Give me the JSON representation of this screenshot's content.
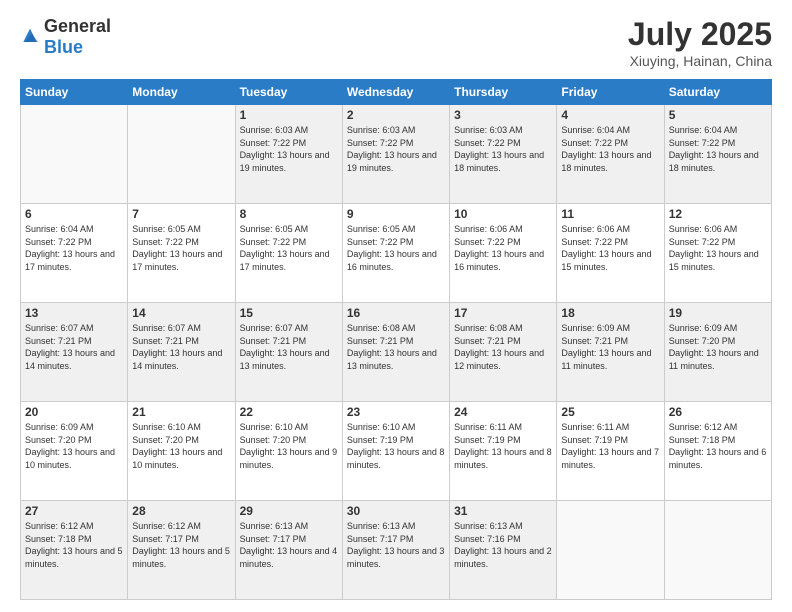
{
  "header": {
    "logo_general": "General",
    "logo_blue": "Blue",
    "month_year": "July 2025",
    "location": "Xiuying, Hainan, China"
  },
  "days_of_week": [
    "Sunday",
    "Monday",
    "Tuesday",
    "Wednesday",
    "Thursday",
    "Friday",
    "Saturday"
  ],
  "weeks": [
    [
      {
        "day": "",
        "sunrise": "",
        "sunset": "",
        "daylight": ""
      },
      {
        "day": "",
        "sunrise": "",
        "sunset": "",
        "daylight": ""
      },
      {
        "day": "1",
        "sunrise": "Sunrise: 6:03 AM",
        "sunset": "Sunset: 7:22 PM",
        "daylight": "Daylight: 13 hours and 19 minutes."
      },
      {
        "day": "2",
        "sunrise": "Sunrise: 6:03 AM",
        "sunset": "Sunset: 7:22 PM",
        "daylight": "Daylight: 13 hours and 19 minutes."
      },
      {
        "day": "3",
        "sunrise": "Sunrise: 6:03 AM",
        "sunset": "Sunset: 7:22 PM",
        "daylight": "Daylight: 13 hours and 18 minutes."
      },
      {
        "day": "4",
        "sunrise": "Sunrise: 6:04 AM",
        "sunset": "Sunset: 7:22 PM",
        "daylight": "Daylight: 13 hours and 18 minutes."
      },
      {
        "day": "5",
        "sunrise": "Sunrise: 6:04 AM",
        "sunset": "Sunset: 7:22 PM",
        "daylight": "Daylight: 13 hours and 18 minutes."
      }
    ],
    [
      {
        "day": "6",
        "sunrise": "Sunrise: 6:04 AM",
        "sunset": "Sunset: 7:22 PM",
        "daylight": "Daylight: 13 hours and 17 minutes."
      },
      {
        "day": "7",
        "sunrise": "Sunrise: 6:05 AM",
        "sunset": "Sunset: 7:22 PM",
        "daylight": "Daylight: 13 hours and 17 minutes."
      },
      {
        "day": "8",
        "sunrise": "Sunrise: 6:05 AM",
        "sunset": "Sunset: 7:22 PM",
        "daylight": "Daylight: 13 hours and 17 minutes."
      },
      {
        "day": "9",
        "sunrise": "Sunrise: 6:05 AM",
        "sunset": "Sunset: 7:22 PM",
        "daylight": "Daylight: 13 hours and 16 minutes."
      },
      {
        "day": "10",
        "sunrise": "Sunrise: 6:06 AM",
        "sunset": "Sunset: 7:22 PM",
        "daylight": "Daylight: 13 hours and 16 minutes."
      },
      {
        "day": "11",
        "sunrise": "Sunrise: 6:06 AM",
        "sunset": "Sunset: 7:22 PM",
        "daylight": "Daylight: 13 hours and 15 minutes."
      },
      {
        "day": "12",
        "sunrise": "Sunrise: 6:06 AM",
        "sunset": "Sunset: 7:22 PM",
        "daylight": "Daylight: 13 hours and 15 minutes."
      }
    ],
    [
      {
        "day": "13",
        "sunrise": "Sunrise: 6:07 AM",
        "sunset": "Sunset: 7:21 PM",
        "daylight": "Daylight: 13 hours and 14 minutes."
      },
      {
        "day": "14",
        "sunrise": "Sunrise: 6:07 AM",
        "sunset": "Sunset: 7:21 PM",
        "daylight": "Daylight: 13 hours and 14 minutes."
      },
      {
        "day": "15",
        "sunrise": "Sunrise: 6:07 AM",
        "sunset": "Sunset: 7:21 PM",
        "daylight": "Daylight: 13 hours and 13 minutes."
      },
      {
        "day": "16",
        "sunrise": "Sunrise: 6:08 AM",
        "sunset": "Sunset: 7:21 PM",
        "daylight": "Daylight: 13 hours and 13 minutes."
      },
      {
        "day": "17",
        "sunrise": "Sunrise: 6:08 AM",
        "sunset": "Sunset: 7:21 PM",
        "daylight": "Daylight: 13 hours and 12 minutes."
      },
      {
        "day": "18",
        "sunrise": "Sunrise: 6:09 AM",
        "sunset": "Sunset: 7:21 PM",
        "daylight": "Daylight: 13 hours and 11 minutes."
      },
      {
        "day": "19",
        "sunrise": "Sunrise: 6:09 AM",
        "sunset": "Sunset: 7:20 PM",
        "daylight": "Daylight: 13 hours and 11 minutes."
      }
    ],
    [
      {
        "day": "20",
        "sunrise": "Sunrise: 6:09 AM",
        "sunset": "Sunset: 7:20 PM",
        "daylight": "Daylight: 13 hours and 10 minutes."
      },
      {
        "day": "21",
        "sunrise": "Sunrise: 6:10 AM",
        "sunset": "Sunset: 7:20 PM",
        "daylight": "Daylight: 13 hours and 10 minutes."
      },
      {
        "day": "22",
        "sunrise": "Sunrise: 6:10 AM",
        "sunset": "Sunset: 7:20 PM",
        "daylight": "Daylight: 13 hours and 9 minutes."
      },
      {
        "day": "23",
        "sunrise": "Sunrise: 6:10 AM",
        "sunset": "Sunset: 7:19 PM",
        "daylight": "Daylight: 13 hours and 8 minutes."
      },
      {
        "day": "24",
        "sunrise": "Sunrise: 6:11 AM",
        "sunset": "Sunset: 7:19 PM",
        "daylight": "Daylight: 13 hours and 8 minutes."
      },
      {
        "day": "25",
        "sunrise": "Sunrise: 6:11 AM",
        "sunset": "Sunset: 7:19 PM",
        "daylight": "Daylight: 13 hours and 7 minutes."
      },
      {
        "day": "26",
        "sunrise": "Sunrise: 6:12 AM",
        "sunset": "Sunset: 7:18 PM",
        "daylight": "Daylight: 13 hours and 6 minutes."
      }
    ],
    [
      {
        "day": "27",
        "sunrise": "Sunrise: 6:12 AM",
        "sunset": "Sunset: 7:18 PM",
        "daylight": "Daylight: 13 hours and 5 minutes."
      },
      {
        "day": "28",
        "sunrise": "Sunrise: 6:12 AM",
        "sunset": "Sunset: 7:17 PM",
        "daylight": "Daylight: 13 hours and 5 minutes."
      },
      {
        "day": "29",
        "sunrise": "Sunrise: 6:13 AM",
        "sunset": "Sunset: 7:17 PM",
        "daylight": "Daylight: 13 hours and 4 minutes."
      },
      {
        "day": "30",
        "sunrise": "Sunrise: 6:13 AM",
        "sunset": "Sunset: 7:17 PM",
        "daylight": "Daylight: 13 hours and 3 minutes."
      },
      {
        "day": "31",
        "sunrise": "Sunrise: 6:13 AM",
        "sunset": "Sunset: 7:16 PM",
        "daylight": "Daylight: 13 hours and 2 minutes."
      },
      {
        "day": "",
        "sunrise": "",
        "sunset": "",
        "daylight": ""
      },
      {
        "day": "",
        "sunrise": "",
        "sunset": "",
        "daylight": ""
      }
    ]
  ]
}
